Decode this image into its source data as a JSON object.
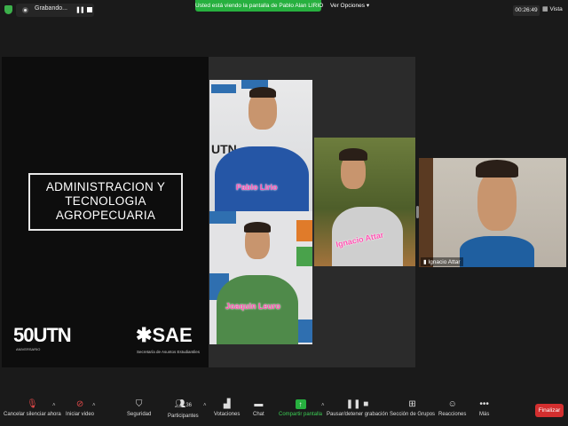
{
  "top_bar": {
    "recording_label": "Grabando...",
    "share_banner": "Usted está viendo la pantalla de Pablo Alan LIRIO",
    "view_options": "Ver Opciones",
    "timer": "00:26:49",
    "view_label": "Vista"
  },
  "slide": {
    "title_lines": [
      "ADMINISTRACION Y",
      "TECNOLOGIA",
      "AGROPECUARIA"
    ],
    "logo_left": "50UTN",
    "logo_left_sub": "ANIVERSARIO",
    "logo_right": "SAE",
    "logo_right_sub": "Secretaría de Asuntos Estudiantiles"
  },
  "participants": [
    {
      "overlay_name": "Pablo Lirio"
    },
    {
      "overlay_name": "Joaquin Leuro"
    },
    {
      "overlay_name": "Ignacio Attar"
    },
    {
      "name_label": "Ignacio Attar"
    }
  ],
  "toolbar": {
    "mute": "Cancelar silenciar ahora",
    "video": "Iniciar video",
    "security": "Seguridad",
    "participants": "Participantes",
    "participants_count": "36",
    "polls": "Votaciones",
    "chat": "Chat",
    "share": "Compartir pantalla",
    "pause_rec": "Pausar/detener grabación",
    "breakout": "Sección de Grupos",
    "reactions": "Reacciones",
    "more": "Más",
    "end": "Finalizar"
  },
  "colors": {
    "share_green": "#27b03f",
    "end_red": "#d32f2f",
    "name_pink": "#ff4fb0"
  }
}
